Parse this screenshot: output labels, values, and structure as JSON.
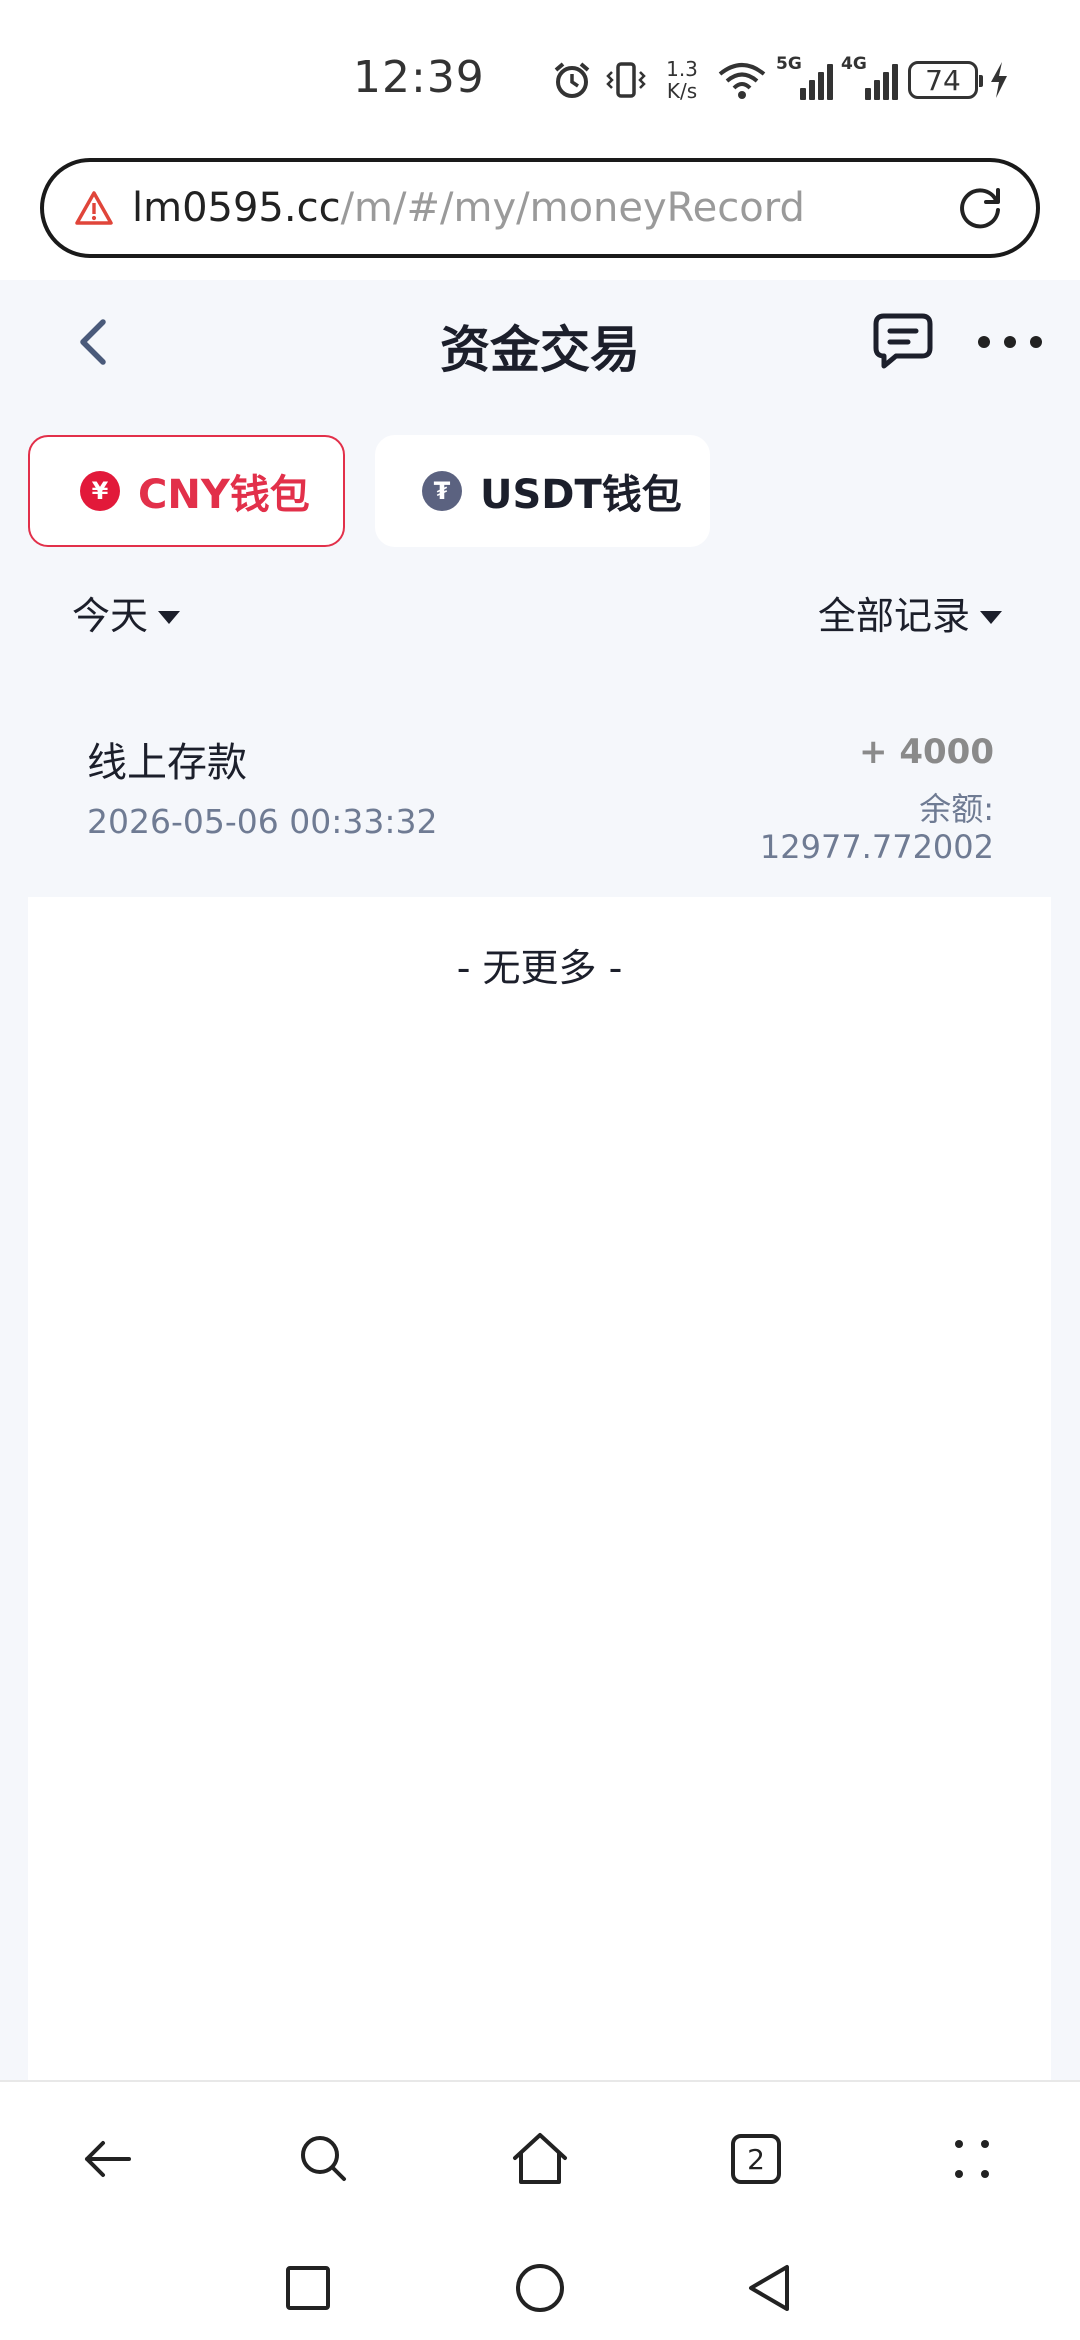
{
  "status_bar": {
    "time": "12:39",
    "net_speed_value": "1.3",
    "net_speed_unit": "K/s",
    "wifi_label": "6",
    "sim1_label": "5G",
    "sim2_label": "4G",
    "battery": "74"
  },
  "url_bar": {
    "host": "lm0595.cc",
    "path": "/m/#/my/moneyRecord"
  },
  "nav": {
    "title": "资金交易"
  },
  "wallet_tabs": [
    {
      "label": "CNY钱包",
      "coin_symbol": "¥",
      "active": true
    },
    {
      "label": "USDT钱包",
      "coin_symbol": "₮",
      "active": false
    }
  ],
  "filters": {
    "date": "今天",
    "type": "全部记录"
  },
  "records": [
    {
      "title": "线上存款",
      "time": "2026-05-06 00:33:32",
      "amount": "+ 4000",
      "balance_label": "余额:",
      "balance_value": "12977.772002"
    }
  ],
  "list_footer": "- 无更多 -",
  "browser_bar": {
    "tab_count": "2"
  },
  "colors": {
    "accent_red": "#e2304a",
    "page_bg": "#f5f7fb",
    "text_dark": "#1c1f2b",
    "text_muted": "#6f7b93"
  }
}
